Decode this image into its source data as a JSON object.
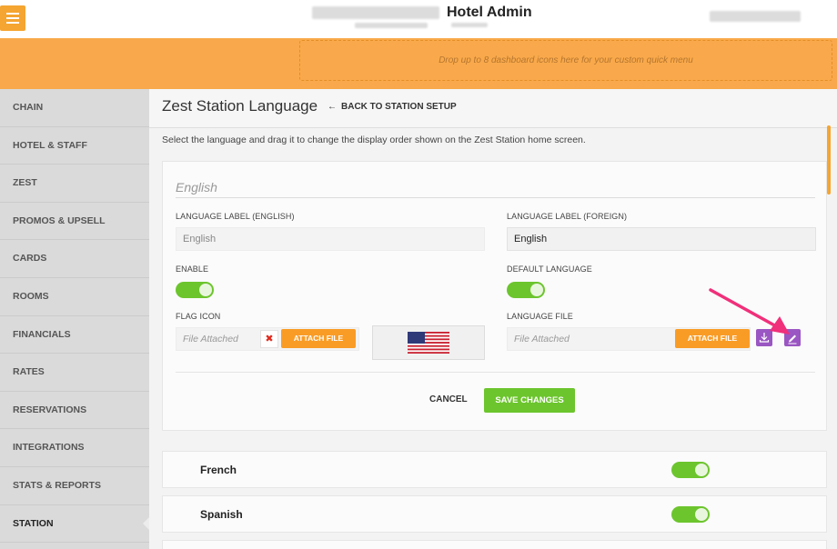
{
  "header": {
    "title": "Hotel Admin",
    "menu_icon": "hamburger-icon",
    "accent_color": "#f5a531"
  },
  "quick_menu": {
    "placeholder": "Drop up to 8 dashboard icons here for your custom quick menu"
  },
  "sidebar": {
    "items": [
      {
        "label": "CHAIN"
      },
      {
        "label": "HOTEL & STAFF"
      },
      {
        "label": "ZEST"
      },
      {
        "label": "PROMOS & UPSELL"
      },
      {
        "label": "CARDS"
      },
      {
        "label": "ROOMS"
      },
      {
        "label": "FINANCIALS"
      },
      {
        "label": "RATES"
      },
      {
        "label": "RESERVATIONS"
      },
      {
        "label": "INTEGRATIONS"
      },
      {
        "label": "STATS & REPORTS"
      },
      {
        "label": "STATION"
      }
    ],
    "active": "STATION"
  },
  "page": {
    "title": "Zest Station Language",
    "back_link": "BACK TO STATION SETUP",
    "description": "Select the language and drag it to change the display order shown on the Zest Station home screen."
  },
  "language_card": {
    "title": "English",
    "label_english": {
      "label": "LANGUAGE LABEL (ENGLISH)",
      "placeholder": "English"
    },
    "label_foreign": {
      "label": "LANGUAGE LABEL (FOREIGN)",
      "value": "English"
    },
    "enable": {
      "label": "ENABLE",
      "on": true
    },
    "default_language": {
      "label": "DEFAULT LANGUAGE",
      "on": true
    },
    "flag_icon": {
      "label": "FLAG ICON",
      "file_placeholder": "File Attached",
      "remove_icon": "remove-x-icon",
      "attach_label": "ATTACH FILE",
      "preview_icon": "us-flag-icon"
    },
    "language_file": {
      "label": "LANGUAGE FILE",
      "file_placeholder": "File Attached",
      "attach_label": "ATTACH FILE",
      "download_icon": "download-icon",
      "edit_icon": "pencil-icon"
    },
    "cancel_label": "CANCEL",
    "save_label": "SAVE CHANGES"
  },
  "languages": [
    {
      "name": "French",
      "enabled": true
    },
    {
      "name": "Spanish",
      "enabled": true
    }
  ],
  "colors": {
    "toggle_on": "#6cc52d",
    "attach_button": "#f99c26",
    "icon_button": "#9a56c2",
    "callout_arrow": "#f0307a"
  }
}
